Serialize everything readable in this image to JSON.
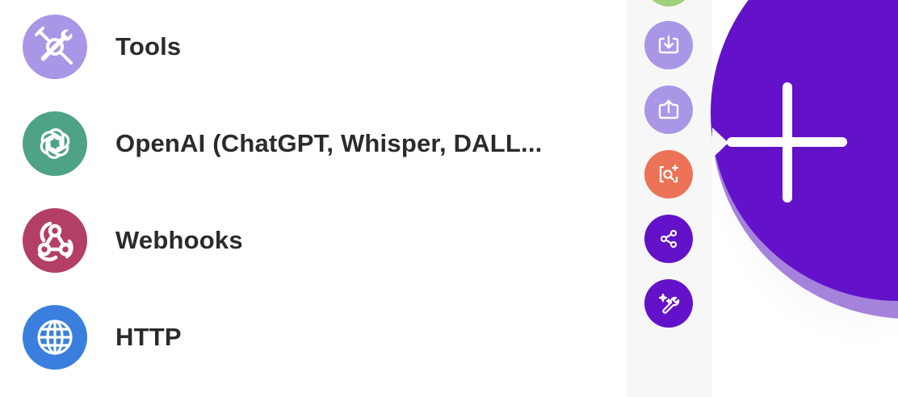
{
  "apps": [
    {
      "label": "Tools",
      "icon": "tools-icon",
      "color": "#a996e6"
    },
    {
      "label": "OpenAI (ChatGPT, Whisper, DALL...",
      "icon": "openai-icon",
      "color": "#4fa385"
    },
    {
      "label": "Webhooks",
      "icon": "webhooks-icon",
      "color": "#b33f64"
    },
    {
      "label": "HTTP",
      "icon": "globe-icon",
      "color": "#3a7fde"
    }
  ],
  "toolbar": {
    "buttons": [
      {
        "icon": "import-icon",
        "color": "#a996e6"
      },
      {
        "icon": "export-icon",
        "color": "#a996e6"
      },
      {
        "icon": "search-scan-icon",
        "color": "#ec7357"
      },
      {
        "icon": "share-icon",
        "color": "#6312c9"
      },
      {
        "icon": "magic-wrench-icon",
        "color": "#6312c9"
      }
    ]
  },
  "add_module": {
    "icon": "plus-icon",
    "core_color": "#6312c9",
    "ring_color": "#a583dc"
  }
}
